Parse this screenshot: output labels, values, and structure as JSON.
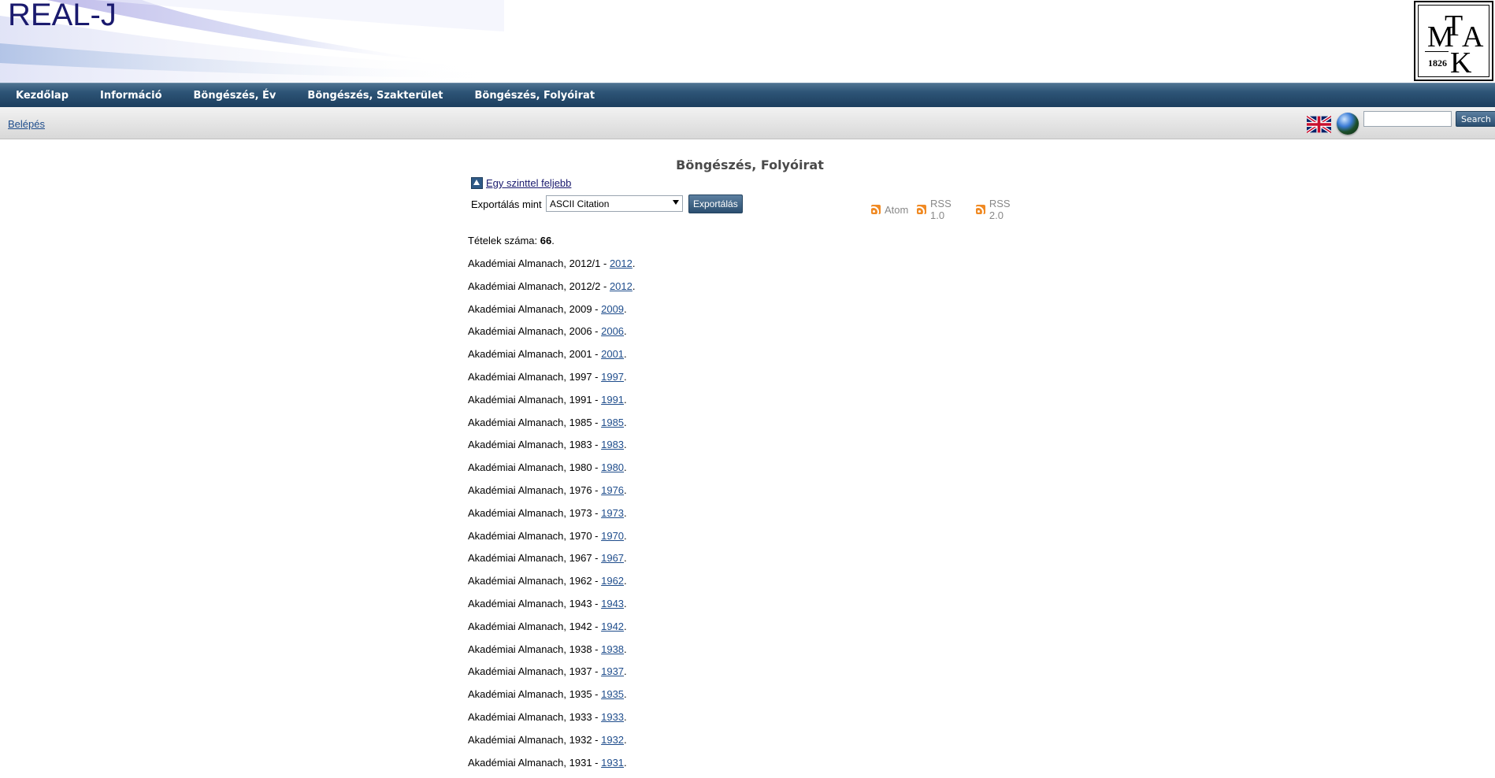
{
  "header": {
    "site_title": "REAL-J",
    "logo": {
      "letters": [
        "M",
        "T",
        "A",
        "K"
      ],
      "year": "1826"
    }
  },
  "nav": {
    "items": [
      {
        "label": "Kezdőlap"
      },
      {
        "label": "Információ"
      },
      {
        "label": "Böngészés, Év"
      },
      {
        "label": "Böngészés, Szakterület"
      },
      {
        "label": "Böngészés, Folyóirat"
      }
    ]
  },
  "subbar": {
    "login_label": "Belépés",
    "search_value": "",
    "search_button_label": "Search",
    "flag_icon": "uk-flag-icon",
    "globe_icon": "globe-icon"
  },
  "main": {
    "page_title": "Böngészés, Folyóirat",
    "up_link_label": "Egy szinttel feljebb",
    "export_label": "Exportálás mint",
    "export_selected": "ASCII Citation",
    "export_button_label": "Exportálás",
    "feeds": [
      {
        "label": "Atom"
      },
      {
        "label": "RSS 1.0"
      },
      {
        "label": "RSS 2.0"
      }
    ],
    "count_prefix": "Tételek száma: ",
    "count_value": "66",
    "count_suffix": ".",
    "items": [
      {
        "text": "Akadémiai Almanach, 2012/1 - ",
        "link": "2012"
      },
      {
        "text": "Akadémiai Almanach, 2012/2 - ",
        "link": "2012"
      },
      {
        "text": "Akadémiai Almanach, 2009 - ",
        "link": "2009"
      },
      {
        "text": "Akadémiai Almanach, 2006 - ",
        "link": "2006"
      },
      {
        "text": "Akadémiai Almanach, 2001 - ",
        "link": "2001"
      },
      {
        "text": "Akadémiai Almanach, 1997 - ",
        "link": "1997"
      },
      {
        "text": "Akadémiai Almanach, 1991 - ",
        "link": "1991"
      },
      {
        "text": "Akadémiai Almanach, 1985 - ",
        "link": "1985"
      },
      {
        "text": "Akadémiai Almanach, 1983 - ",
        "link": "1983"
      },
      {
        "text": "Akadémiai Almanach, 1980 - ",
        "link": "1980"
      },
      {
        "text": "Akadémiai Almanach, 1976 - ",
        "link": "1976"
      },
      {
        "text": "Akadémiai Almanach, 1973 - ",
        "link": "1973"
      },
      {
        "text": "Akadémiai Almanach, 1970 - ",
        "link": "1970"
      },
      {
        "text": "Akadémiai Almanach, 1967 - ",
        "link": "1967"
      },
      {
        "text": "Akadémiai Almanach, 1962 - ",
        "link": "1962"
      },
      {
        "text": "Akadémiai Almanach, 1943 - ",
        "link": "1943"
      },
      {
        "text": "Akadémiai Almanach, 1942 - ",
        "link": "1942"
      },
      {
        "text": "Akadémiai Almanach, 1938 - ",
        "link": "1938"
      },
      {
        "text": "Akadémiai Almanach, 1937 - ",
        "link": "1937"
      },
      {
        "text": "Akadémiai Almanach, 1935 - ",
        "link": "1935"
      },
      {
        "text": "Akadémiai Almanach, 1933 - ",
        "link": "1933"
      },
      {
        "text": "Akadémiai Almanach, 1932 - ",
        "link": "1932"
      },
      {
        "text": "Akadémiai Almanach, 1931 - ",
        "link": "1931"
      }
    ],
    "item_suffix": "."
  },
  "colors": {
    "nav_bar": "#2e5577",
    "site_title": "#1a1a6e",
    "link": "#1f4d8c",
    "feed_icon": "#f08a24"
  }
}
